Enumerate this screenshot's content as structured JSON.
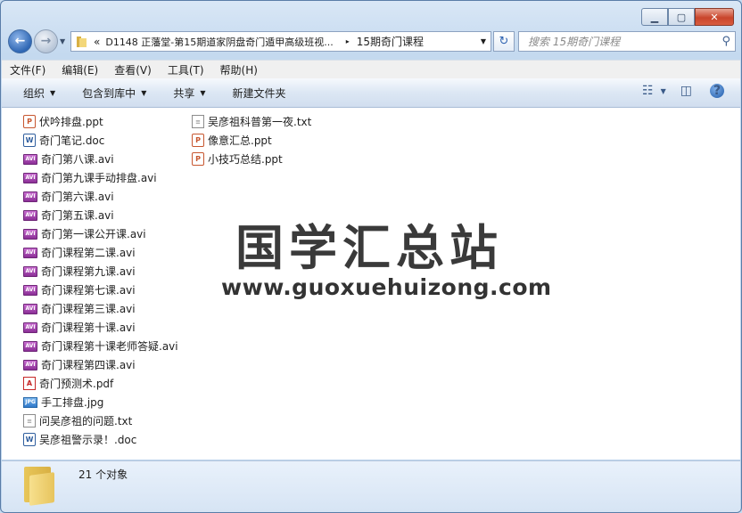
{
  "window": {
    "min_label": "▁",
    "max_label": "▢",
    "close_label": "✕"
  },
  "address": {
    "overflow": "«",
    "crumb1": "D1148 正藩堂-第15期道家阴盘奇门遁甲高级班视...",
    "separator": "▸",
    "crumb2": "15期奇门课程"
  },
  "search": {
    "placeholder": "搜索 15期奇门课程"
  },
  "menu": [
    "文件(F)",
    "编辑(E)",
    "查看(V)",
    "工具(T)",
    "帮助(H)"
  ],
  "toolbar": {
    "organize": "组织",
    "include": "包含到库中",
    "share": "共享",
    "new_folder": "新建文件夹"
  },
  "files": {
    "col1": [
      {
        "name": "伏吟排盘.ppt",
        "type": "ppt"
      },
      {
        "name": "奇门笔记.doc",
        "type": "doc"
      },
      {
        "name": "奇门第八课.avi",
        "type": "avi"
      },
      {
        "name": "奇门第九课手动排盘.avi",
        "type": "avi"
      },
      {
        "name": "奇门第六课.avi",
        "type": "avi"
      },
      {
        "name": "奇门第五课.avi",
        "type": "avi"
      },
      {
        "name": "奇门第一课公开课.avi",
        "type": "avi"
      },
      {
        "name": "奇门课程第二课.avi",
        "type": "avi"
      },
      {
        "name": "奇门课程第九课.avi",
        "type": "avi"
      },
      {
        "name": "奇门课程第七课.avi",
        "type": "avi"
      },
      {
        "name": "奇门课程第三课.avi",
        "type": "avi"
      },
      {
        "name": "奇门课程第十课.avi",
        "type": "avi"
      },
      {
        "name": "奇门课程第十课老师答疑.avi",
        "type": "avi"
      },
      {
        "name": "奇门课程第四课.avi",
        "type": "avi"
      },
      {
        "name": "奇门预测术.pdf",
        "type": "pdf"
      },
      {
        "name": "手工排盘.jpg",
        "type": "jpg"
      },
      {
        "name": "问吴彦祖的问题.txt",
        "type": "txt"
      },
      {
        "name": "吴彦祖警示录！.doc",
        "type": "doc"
      }
    ],
    "col2": [
      {
        "name": "吴彦祖科普第一夜.txt",
        "type": "txt"
      },
      {
        "name": "像意汇总.ppt",
        "type": "ppt"
      },
      {
        "name": "小技巧总结.ppt",
        "type": "ppt"
      }
    ]
  },
  "watermark": {
    "title": "国学汇总站",
    "url": "www.guoxuehuizong.com"
  },
  "status": {
    "count": "21 个对象"
  }
}
